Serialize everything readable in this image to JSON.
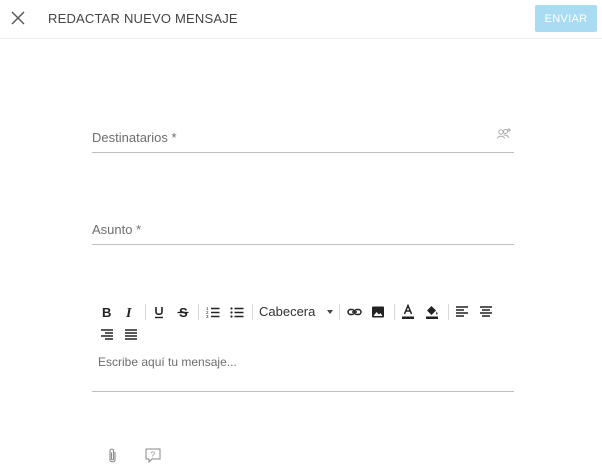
{
  "header": {
    "title": "REDACTAR NUEVO MENSAJE",
    "send_label": "ENVIAR",
    "close_icon": "close-icon"
  },
  "form": {
    "recipients_label": "Destinatarios *",
    "subject_label": "Asunto *"
  },
  "editor": {
    "format_select_value": "Cabecera",
    "placeholder": "Escribe aquí tu mensaje...",
    "toolbar_icons": [
      "bold-icon",
      "italic-icon",
      "underline-icon",
      "strikethrough-icon",
      "ordered-list-icon",
      "bullet-list-icon",
      "link-icon",
      "image-icon",
      "text-color-icon",
      "fill-color-icon",
      "align-left-icon",
      "align-center-icon",
      "align-right-icon",
      "justify-icon"
    ]
  },
  "footer": {
    "icons": [
      "paperclip-icon",
      "help-icon"
    ]
  },
  "colors": {
    "send_button": "#a9dcf2",
    "divider": "#bdbdbd"
  }
}
